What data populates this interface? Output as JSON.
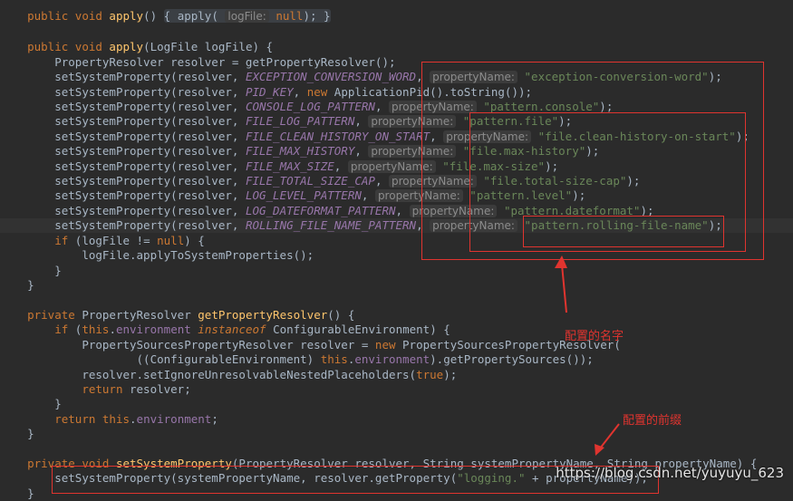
{
  "code": {
    "l1": {
      "kw1": "public void ",
      "fn": "apply",
      "t1": "() ",
      "fold": "{ apply( ",
      "hint": "logFile:",
      "kw2": " null",
      "t2": "); }"
    },
    "l3": {
      "kw1": "public void ",
      "fn": "apply",
      "t1": "(LogFile logFile) {"
    },
    "l4": {
      "t1": "PropertyResolver resolver = getPropertyResolver();"
    },
    "props": [
      {
        "const": "EXCEPTION_CONVERSION_WORD",
        "hint": "propertyName:",
        "str": "\"exception-conversion-word\""
      },
      {
        "const": "CONSOLE_LOG_PATTERN",
        "hint": "propertyName:",
        "str": "\"pattern.console\""
      },
      {
        "const": "FILE_LOG_PATTERN",
        "hint": "propertyName:",
        "str": "\"pattern.file\""
      },
      {
        "const": "FILE_CLEAN_HISTORY_ON_START",
        "hint": "propertyName:",
        "str": "\"file.clean-history-on-start\""
      },
      {
        "const": "FILE_MAX_HISTORY",
        "hint": "propertyName:",
        "str": "\"file.max-history\""
      },
      {
        "const": "FILE_MAX_SIZE",
        "hint": "propertyName:",
        "str": "\"file.max-size\""
      },
      {
        "const": "FILE_TOTAL_SIZE_CAP",
        "hint": "propertyName:",
        "str": "\"file.total-size-cap\""
      },
      {
        "const": "LOG_LEVEL_PATTERN",
        "hint": "propertyName:",
        "str": "\"pattern.level\""
      },
      {
        "const": "LOG_DATEFORMAT_PATTERN",
        "hint": "propertyName:",
        "str": "\"pattern.dateformat\""
      },
      {
        "const": "ROLLING_FILE_NAME_PATTERN",
        "hint": "propertyName:",
        "str": "\"pattern.rolling-file-name\""
      }
    ],
    "call_prefix": "setSystemProperty(resolver, ",
    "call_suffix": ");",
    "pid": {
      "const": "PID_KEY",
      "t1": ", ",
      "kw": "new",
      "t2": " ApplicationPid().toString());"
    },
    "l15": {
      "kw": "if",
      "t1": " (logFile != ",
      "kw2": "null",
      "t2": ") {"
    },
    "l16": {
      "t1": "logFile.applyToSystemProperties();"
    },
    "close_inner": "}",
    "close_outer": "}",
    "l20": {
      "kw": "private",
      "t1": " PropertyResolver ",
      "fn": "getPropertyResolver",
      "t2": "() {"
    },
    "l21": {
      "kw": "if",
      "t1": " (",
      "kw2": "this",
      "t2": ".",
      "fld": "environment",
      "kw3": " instanceof",
      "t3": " ConfigurableEnvironment) {"
    },
    "l22": {
      "t1": "PropertySourcesPropertyResolver resolver = ",
      "kw": "new",
      "t2": " PropertySourcesPropertyResolver("
    },
    "l23": {
      "t1": "((ConfigurableEnvironment) ",
      "kw": "this",
      "t2": ".",
      "fld": "environment",
      "t3": ").getPropertySources());"
    },
    "l24": {
      "t1": "resolver.setIgnoreUnresolvableNestedPlaceholders(",
      "kw": "true",
      "t2": ");"
    },
    "l25": {
      "kw": "return",
      "t1": " resolver;"
    },
    "l27": {
      "kw": "return",
      "t1": " ",
      "kw2": "this",
      "t2": ".",
      "fld": "environment",
      "t3": ";"
    },
    "l30": {
      "kw": "private void ",
      "fn": "setSystemProperty",
      "t1": "(PropertyResolver resolver, String systemPropertyName, String propertyName) {"
    },
    "l31": {
      "t1": "setSystemProperty(systemPropertyName, resolver.getProperty(",
      "str": "\"logging.\"",
      "t2": " + propertyName));"
    }
  },
  "annotations": {
    "name_label": "配置的名字",
    "prefix_label": "配置的前缀"
  },
  "watermark": "https://blog.csdn.net/yuyuyu_623",
  "colors": {
    "annotation": "#e0342f",
    "keyword": "#cc7832",
    "function": "#ffc66d",
    "constant": "#9876aa",
    "string": "#6a8759"
  }
}
